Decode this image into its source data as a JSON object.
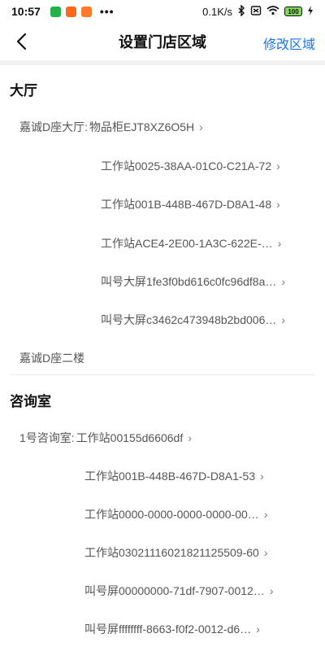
{
  "status_bar": {
    "time": "10:57",
    "more": "•••",
    "net_speed": "0.1K/s",
    "battery": "100"
  },
  "nav": {
    "title": "设置门店区域",
    "action": "修改区域"
  },
  "sections": [
    {
      "title": "大厅",
      "group_label": "嘉诚D座大厅:",
      "items": [
        "物品柜EJT8XZ6O5H",
        "工作站0025-38AA-01C0-C21A-72",
        "工作站001B-448B-467D-D8A1-48",
        "工作站ACE4-2E00-1A3C-622E-…",
        "叫号大屏1fe3f0bd616c0fc96df8a…",
        "叫号大屏c3462c473948b2bd006…"
      ],
      "extra": "嘉诚D座二楼"
    },
    {
      "title": "咨询室",
      "group_label": "1号咨询室:",
      "items": [
        "工作站00155d6606df",
        "工作站001B-448B-467D-D8A1-53",
        "工作站0000-0000-0000-0000-00…",
        "工作站0302111602182112550​9-60",
        "叫号屏00000000-71df-7907-0012…",
        "叫号屏ffffffff-8663-f0f2-0012-d6…"
      ]
    }
  ]
}
